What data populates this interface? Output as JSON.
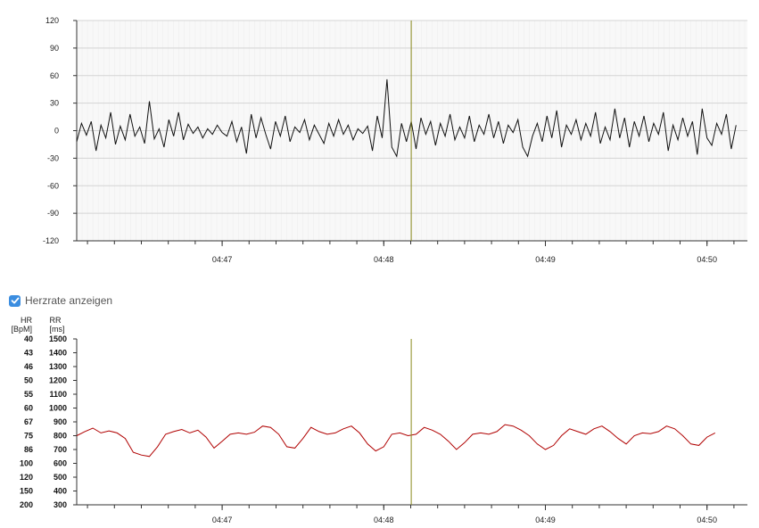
{
  "toggle": {
    "label": "Herzrate anzeigen",
    "checked": true
  },
  "colors": {
    "ecg_line": "#111111",
    "rr_line": "#b00000",
    "cursor": "#8a8a1e",
    "plot_bg": "#f8f8f8",
    "grid": "#d4d4d4",
    "checkbox": "#3b8de0"
  },
  "chart_data": [
    {
      "type": "line",
      "title": "",
      "xlabel": "",
      "ylabel": "",
      "ylim": [
        -120,
        120
      ],
      "yticks": [
        "120",
        "90",
        "60",
        "30",
        "0",
        "-30",
        "-60",
        "-90",
        "-120"
      ],
      "xticks": [
        "04:47",
        "04:48",
        "04:49",
        "04:50"
      ],
      "xlim_min": [
        46.1,
        50.25
      ],
      "cursor_min": 48.17,
      "grid": true,
      "series": [
        {
          "values_x_min": [
            46.1,
            46.13,
            46.16,
            46.19,
            46.22,
            46.25,
            46.28,
            46.31,
            46.34,
            46.37,
            46.4,
            46.43,
            46.46,
            46.49,
            46.52,
            46.55,
            46.58,
            46.61,
            46.64,
            46.67,
            46.7,
            46.73,
            46.76,
            46.79,
            46.82,
            46.85,
            46.88,
            46.91,
            46.94,
            46.97,
            47.0,
            47.03,
            47.06,
            47.09,
            47.12,
            47.15,
            47.18,
            47.21,
            47.24,
            47.27,
            47.3,
            47.33,
            47.36,
            47.39,
            47.42,
            47.45,
            47.48,
            47.51,
            47.54,
            47.57,
            47.6,
            47.63,
            47.66,
            47.69,
            47.72,
            47.75,
            47.78,
            47.81,
            47.84,
            47.87,
            47.9,
            47.93,
            47.96,
            47.99,
            48.02,
            48.05,
            48.08,
            48.11,
            48.14,
            48.17,
            48.2,
            48.23,
            48.26,
            48.29,
            48.32,
            48.35,
            48.38,
            48.41,
            48.44,
            48.47,
            48.5,
            48.53,
            48.56,
            48.59,
            48.62,
            48.65,
            48.68,
            48.71,
            48.74,
            48.77,
            48.8,
            48.83,
            48.86,
            48.89,
            48.92,
            48.95,
            48.98,
            49.01,
            49.04,
            49.07,
            49.1,
            49.13,
            49.16,
            49.19,
            49.22,
            49.25,
            49.28,
            49.31,
            49.34,
            49.37,
            49.4,
            49.43,
            49.46,
            49.49,
            49.52,
            49.55,
            49.58,
            49.61,
            49.64,
            49.67,
            49.7,
            49.73,
            49.76,
            49.79,
            49.82,
            49.85,
            49.88,
            49.91,
            49.94,
            49.97,
            50.0,
            50.03,
            50.06,
            50.09,
            50.12,
            50.15,
            50.18,
            50.21,
            50.24
          ],
          "values_y": [
            -12,
            8,
            -5,
            10,
            -22,
            6,
            -8,
            20,
            -15,
            5,
            -10,
            18,
            -6,
            4,
            -14,
            32,
            -9,
            2,
            -18,
            12,
            -6,
            20,
            -10,
            7,
            -3,
            4,
            -8,
            2,
            -4,
            6,
            -2,
            -6,
            10,
            -12,
            4,
            -25,
            18,
            -8,
            14,
            -4,
            -20,
            10,
            -6,
            16,
            -12,
            4,
            -2,
            12,
            -10,
            6,
            -4,
            -14,
            8,
            -6,
            12,
            -4,
            6,
            -10,
            2,
            -3,
            5,
            -22,
            16,
            -8,
            56,
            -18,
            -28,
            8,
            -12,
            10,
            -20,
            14,
            -4,
            10,
            -16,
            8,
            -6,
            18,
            -10,
            4,
            -8,
            16,
            -12,
            6,
            -4,
            18,
            -8,
            10,
            -14,
            6,
            -2,
            12,
            -18,
            -28,
            -6,
            8,
            -12,
            16,
            -8,
            22,
            -18,
            6,
            -4,
            12,
            -10,
            8,
            -6,
            20,
            -14,
            4,
            -10,
            24,
            -8,
            14,
            -18,
            10,
            -6,
            16,
            -12,
            8,
            -4,
            20,
            -22,
            6,
            -10,
            14,
            -6,
            10,
            -26,
            24,
            -8,
            -16,
            8,
            -4,
            18,
            -20,
            6
          ]
        }
      ]
    },
    {
      "type": "line",
      "title": "",
      "ylabel_left": "HR [BpM]",
      "ylabel_right": "RR [ms]",
      "ylabel_left_line1": "HR",
      "ylabel_left_line2": "[BpM]",
      "ylabel_right_line1": "RR",
      "ylabel_right_line2": "[ms]",
      "ylim": [
        300,
        1500
      ],
      "hr_ticks": [
        "40",
        "43",
        "46",
        "50",
        "55",
        "60",
        "67",
        "75",
        "86",
        "100",
        "120",
        "150",
        "200"
      ],
      "rr_ticks": [
        "1500",
        "1400",
        "1300",
        "1200",
        "1100",
        "1000",
        "900",
        "800",
        "700",
        "600",
        "500",
        "400",
        "300"
      ],
      "xticks": [
        "04:47",
        "04:48",
        "04:49",
        "04:50"
      ],
      "xlim_min": [
        46.1,
        50.25
      ],
      "cursor_min": 48.17,
      "grid": false,
      "series": [
        {
          "values_x_min": [
            46.1,
            46.15,
            46.2,
            46.25,
            46.3,
            46.35,
            46.4,
            46.45,
            46.5,
            46.55,
            46.6,
            46.65,
            46.7,
            46.75,
            46.8,
            46.85,
            46.9,
            46.95,
            47.0,
            47.05,
            47.1,
            47.15,
            47.2,
            47.25,
            47.3,
            47.35,
            47.4,
            47.45,
            47.5,
            47.55,
            47.6,
            47.65,
            47.7,
            47.75,
            47.8,
            47.85,
            47.9,
            47.95,
            48.0,
            48.05,
            48.1,
            48.15,
            48.2,
            48.25,
            48.3,
            48.35,
            48.4,
            48.45,
            48.5,
            48.55,
            48.6,
            48.65,
            48.7,
            48.75,
            48.8,
            48.85,
            48.9,
            48.95,
            49.0,
            49.05,
            49.1,
            49.15,
            49.2,
            49.25,
            49.3,
            49.35,
            49.4,
            49.45,
            49.5,
            49.55,
            49.6,
            49.65,
            49.7,
            49.75,
            49.8,
            49.85,
            49.9,
            49.95,
            50.0,
            50.05,
            50.1,
            50.15,
            50.2,
            50.25
          ],
          "values_y": [
            800,
            830,
            855,
            820,
            835,
            820,
            780,
            680,
            660,
            650,
            720,
            810,
            830,
            845,
            820,
            840,
            790,
            710,
            760,
            810,
            820,
            810,
            825,
            870,
            860,
            810,
            720,
            710,
            780,
            860,
            830,
            810,
            820,
            850,
            870,
            820,
            740,
            690,
            720,
            810,
            820,
            800,
            810,
            860,
            840,
            810,
            760,
            700,
            750,
            810,
            820,
            810,
            830,
            880,
            870,
            840,
            800,
            740,
            700,
            730,
            800,
            850,
            830,
            810,
            850,
            870,
            830,
            780,
            740,
            800,
            820,
            815,
            830,
            870,
            850,
            800,
            740,
            730,
            790,
            820
          ],
          "name": ""
        }
      ]
    }
  ]
}
